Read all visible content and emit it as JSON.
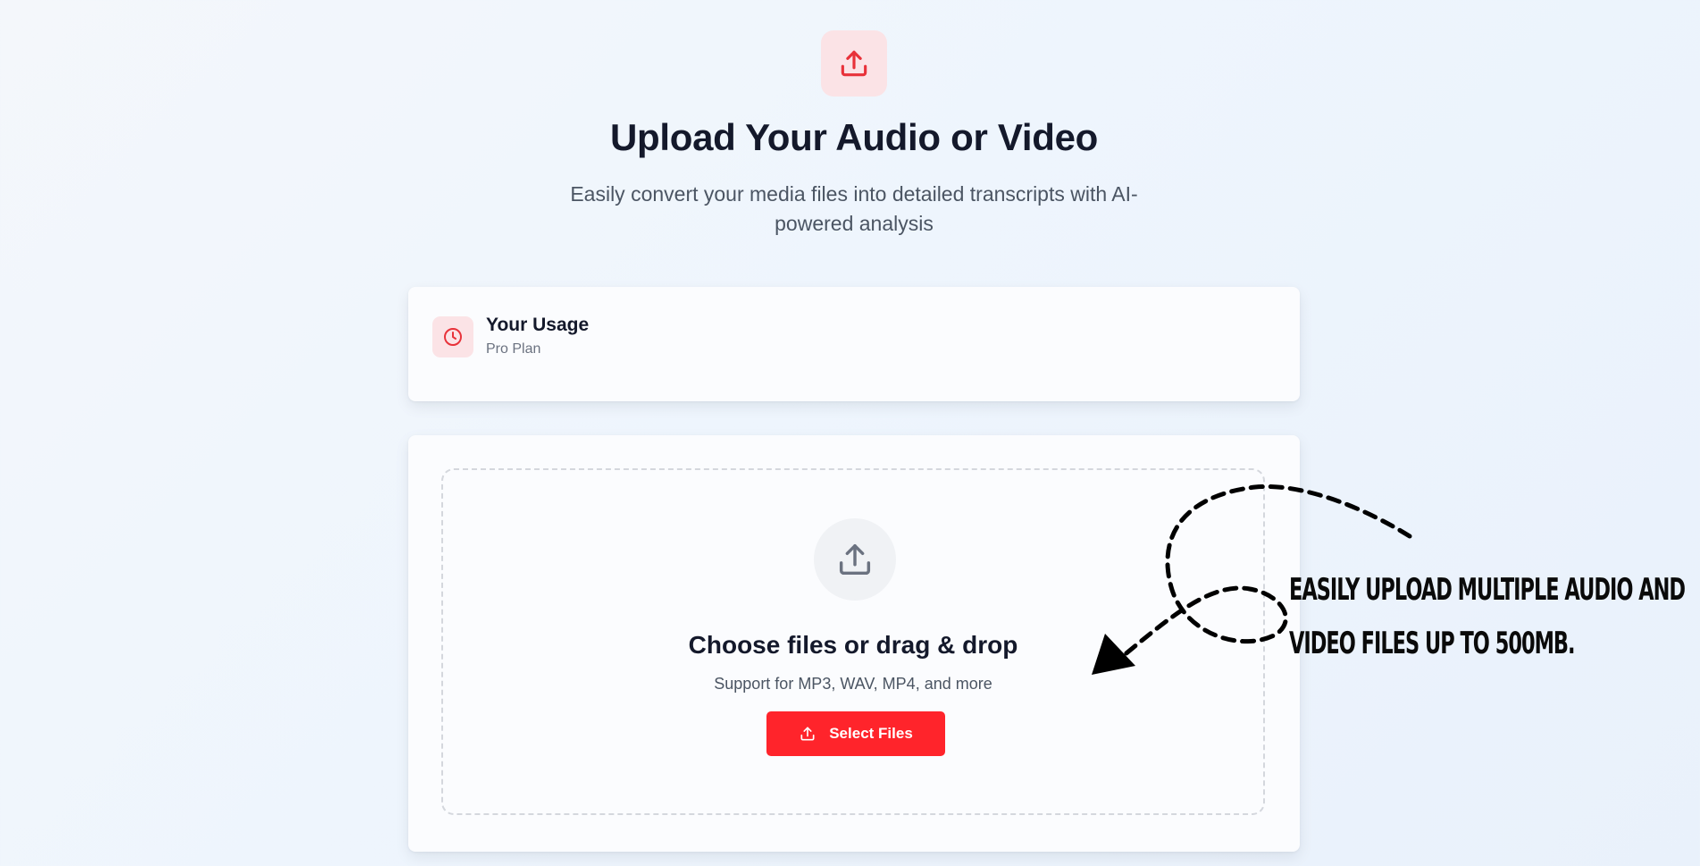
{
  "header": {
    "icon": "upload-icon",
    "title": "Upload Your Audio or Video",
    "subtitle": "Easily convert your media files into detailed transcripts with AI-powered analysis"
  },
  "usage": {
    "icon": "clock-icon",
    "title": "Your Usage",
    "plan": "Pro Plan"
  },
  "upload": {
    "icon": "upload-icon",
    "title": "Choose files or drag & drop",
    "support": "Support for MP3, WAV, MP4, and more",
    "button_label": "Select Files",
    "button_icon": "upload-icon"
  },
  "annotation": {
    "line1": "EASILY UPLOAD MULTIPLE AUDIO AND",
    "line2": "VIDEO FILES UP TO 500MB."
  },
  "colors": {
    "accent": "#ff242b",
    "accent_soft": "#fbe3e6",
    "title": "#14192b",
    "muted": "#4b5563"
  }
}
